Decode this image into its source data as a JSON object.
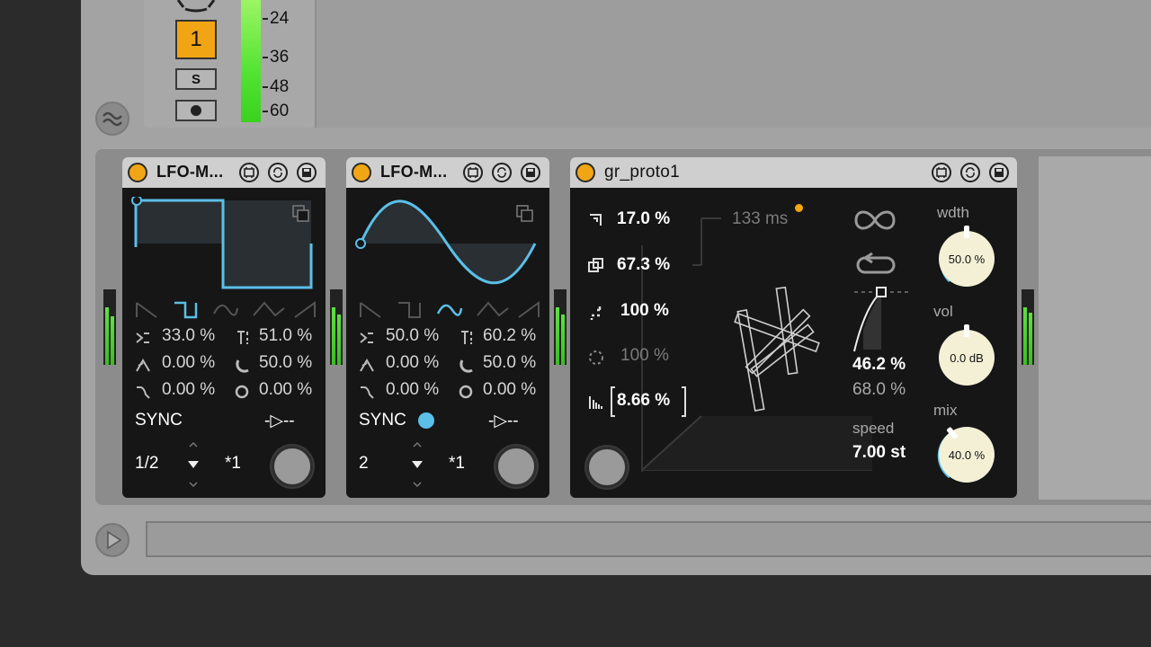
{
  "track": {
    "number": "1",
    "solo_label": "S",
    "meter_scale": [
      "24",
      "36",
      "48",
      "60"
    ]
  },
  "devices": [
    {
      "title": "LFO-M...",
      "shape_selected": "square",
      "params": {
        "jitter": "33.0 %",
        "smooth": "51.0 %",
        "attack": "0.00 %",
        "phase": "50.0 %",
        "decay": "0.00 %",
        "offset": "0.00 %"
      },
      "sync_label": "SYNC",
      "sync_active": false,
      "play_mode": "-▷--",
      "rate": "1/2",
      "multiplier": "*1"
    },
    {
      "title": "LFO-M...",
      "shape_selected": "sine",
      "params": {
        "jitter": "50.0 %",
        "smooth": "60.2 %",
        "attack": "0.00 %",
        "phase": "50.0 %",
        "decay": "0.00 %",
        "offset": "0.00 %"
      },
      "sync_label": "SYNC",
      "sync_active": true,
      "play_mode": "-▷--",
      "rate": "2",
      "multiplier": "*1"
    },
    {
      "title": "gr_proto1",
      "grain_size": "17.0 %",
      "density": "67.3 %",
      "spray": "100 %",
      "random": "100 %",
      "pitch_spread": "8.66 %",
      "time_ms": "133 ms",
      "curve_value": "46.2 %",
      "curve_value2": "68.0 %",
      "speed_label": "speed",
      "speed_value": "7.00 st",
      "width_label": "wdth",
      "width_value": "50.0 %",
      "vol_label": "vol",
      "vol_value": "0.0 dB",
      "mix_label": "mix",
      "mix_value": "40.0 %"
    }
  ],
  "colors": {
    "accent_orange": "#f2a514",
    "lfo_blue": "#5bbfe8",
    "meter_green": "#52e332",
    "knob_cream": "#f3f0d6"
  }
}
